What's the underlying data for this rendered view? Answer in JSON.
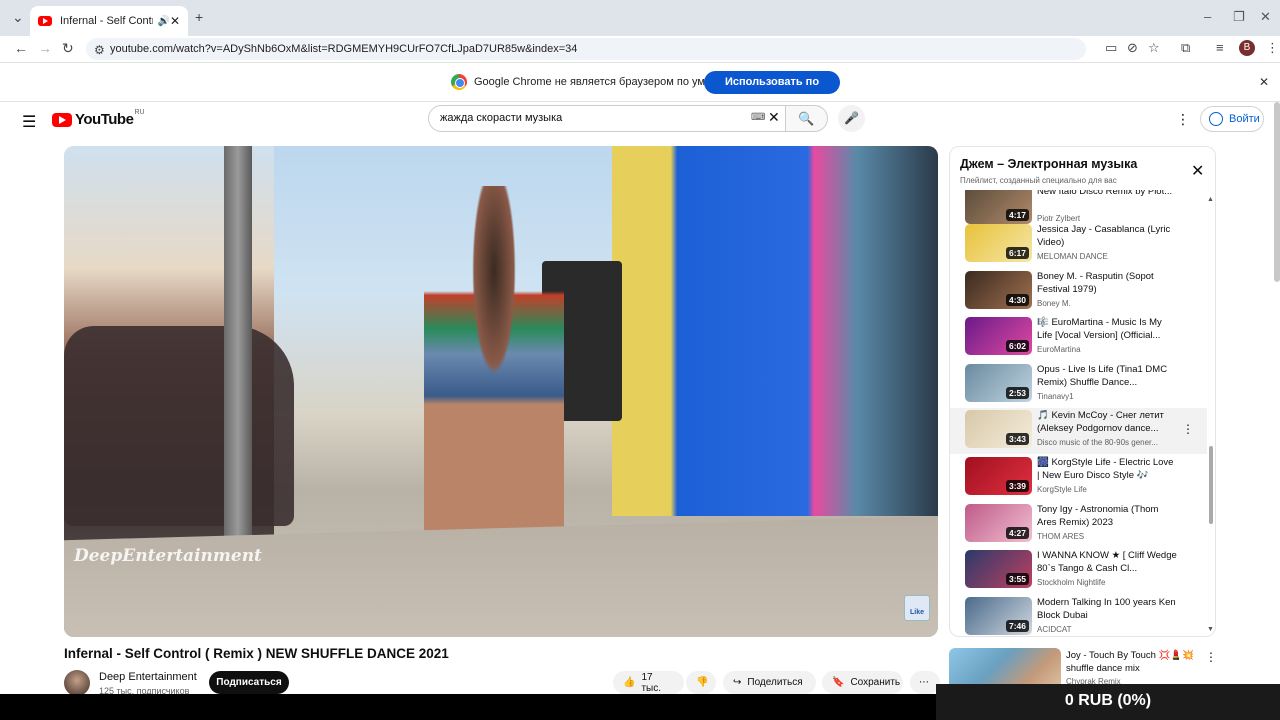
{
  "browser": {
    "tab_title": "Infernal - Self Control ( Remix",
    "audio_icon": "speaker-icon",
    "new_tab_label": "+",
    "url": "youtube.com/watch?v=ADyShNb6OxM&list=RDGMEMYH9CUrFO7CfLJpaD7UR85w&index=34",
    "avatar_letter": "B",
    "infobar_text": "Google Chrome не является браузером по умолчанию.",
    "infobar_button": "Использовать по умолчанию"
  },
  "masthead": {
    "logo_text": "YouTube",
    "logo_country": "RU",
    "search_value": "жажда скорасти музыка",
    "signin_label": "Войти"
  },
  "video": {
    "watermark": "DeepEntertainment",
    "like_badge": "Like",
    "title": "Infernal - Self Control ( Remix ) NEW SHUFFLE DANCE 2021",
    "channel": "Deep Entertainment",
    "subscribers": "125 тыс. подписчиков",
    "subscribe_label": "Подписаться",
    "likes": "17 тыс.",
    "share_label": "Поделиться",
    "save_label": "Сохранить"
  },
  "playlist": {
    "title": "Джем – Электронная музыка",
    "subtitle": "Плейлист, созданный специально для вас",
    "items": [
      {
        "title": "New Italo Disco Remix by Piot...",
        "channel": "Piotr Zylbert",
        "duration": "4:17",
        "colors": [
          "#5a4a3a",
          "#b08a6a"
        ]
      },
      {
        "title": "Jessica Jay - Casablanca (Lyric Video)",
        "channel": "MELOMAN DANCE",
        "duration": "6:17",
        "colors": [
          "#e8c23a",
          "#f5e6a8"
        ]
      },
      {
        "title": "Boney M. - Rasputin (Sopot Festival 1979)",
        "channel": "Boney M.",
        "duration": "4:30",
        "colors": [
          "#3a2a20",
          "#a07050"
        ]
      },
      {
        "title": "🎼 EuroMartina - Music Is My Life [Vocal Version] (Official...",
        "channel": "EuroMartina",
        "duration": "6:02",
        "colors": [
          "#6a1a8a",
          "#e04aa0"
        ]
      },
      {
        "title": "Opus - Live Is Life (Tina1 DMC Remix) Shuffle Dance...",
        "channel": "Tinanavy1",
        "duration": "2:53",
        "colors": [
          "#6a8aa0",
          "#c0d4e0"
        ]
      },
      {
        "title": "🎵 Kevin McCoy - Снег летит (Aleksey Podgornov dance...",
        "channel": "Disco music of the 80-90s gener...",
        "duration": "3:43",
        "colors": [
          "#d8c8a8",
          "#f4ecdc"
        ]
      },
      {
        "title": "🎆 KorgStyle Life - Electric Love | New Euro Disco Style 🎶",
        "channel": "KorgStyle Life",
        "duration": "3:39",
        "colors": [
          "#a01020",
          "#e03040"
        ]
      },
      {
        "title": "Tony Igy - Astronomia (Thom Ares Remix) 2023",
        "channel": "THOM ARES",
        "duration": "4:27",
        "colors": [
          "#c05a8a",
          "#f0c0d0"
        ]
      },
      {
        "title": "I WANNA KNOW ★ [ Cliff Wedge 80`s Tango & Cash Cl...",
        "channel": "Stockholm Nightlife",
        "duration": "3:55",
        "colors": [
          "#2a3a6a",
          "#c04060"
        ]
      },
      {
        "title": "Modern Talking In 100 years Ken Block Dubai",
        "channel": "ACIDCAT",
        "duration": "7:46",
        "colors": [
          "#4a6a8a",
          "#d0d8e0"
        ]
      }
    ]
  },
  "recommendation": {
    "title": "Joy - Touch By Touch 💢💄💥 shuffle dance mix",
    "channel": "Chyprak Remix"
  },
  "overlay": {
    "text": "0 RUB (0%)"
  }
}
